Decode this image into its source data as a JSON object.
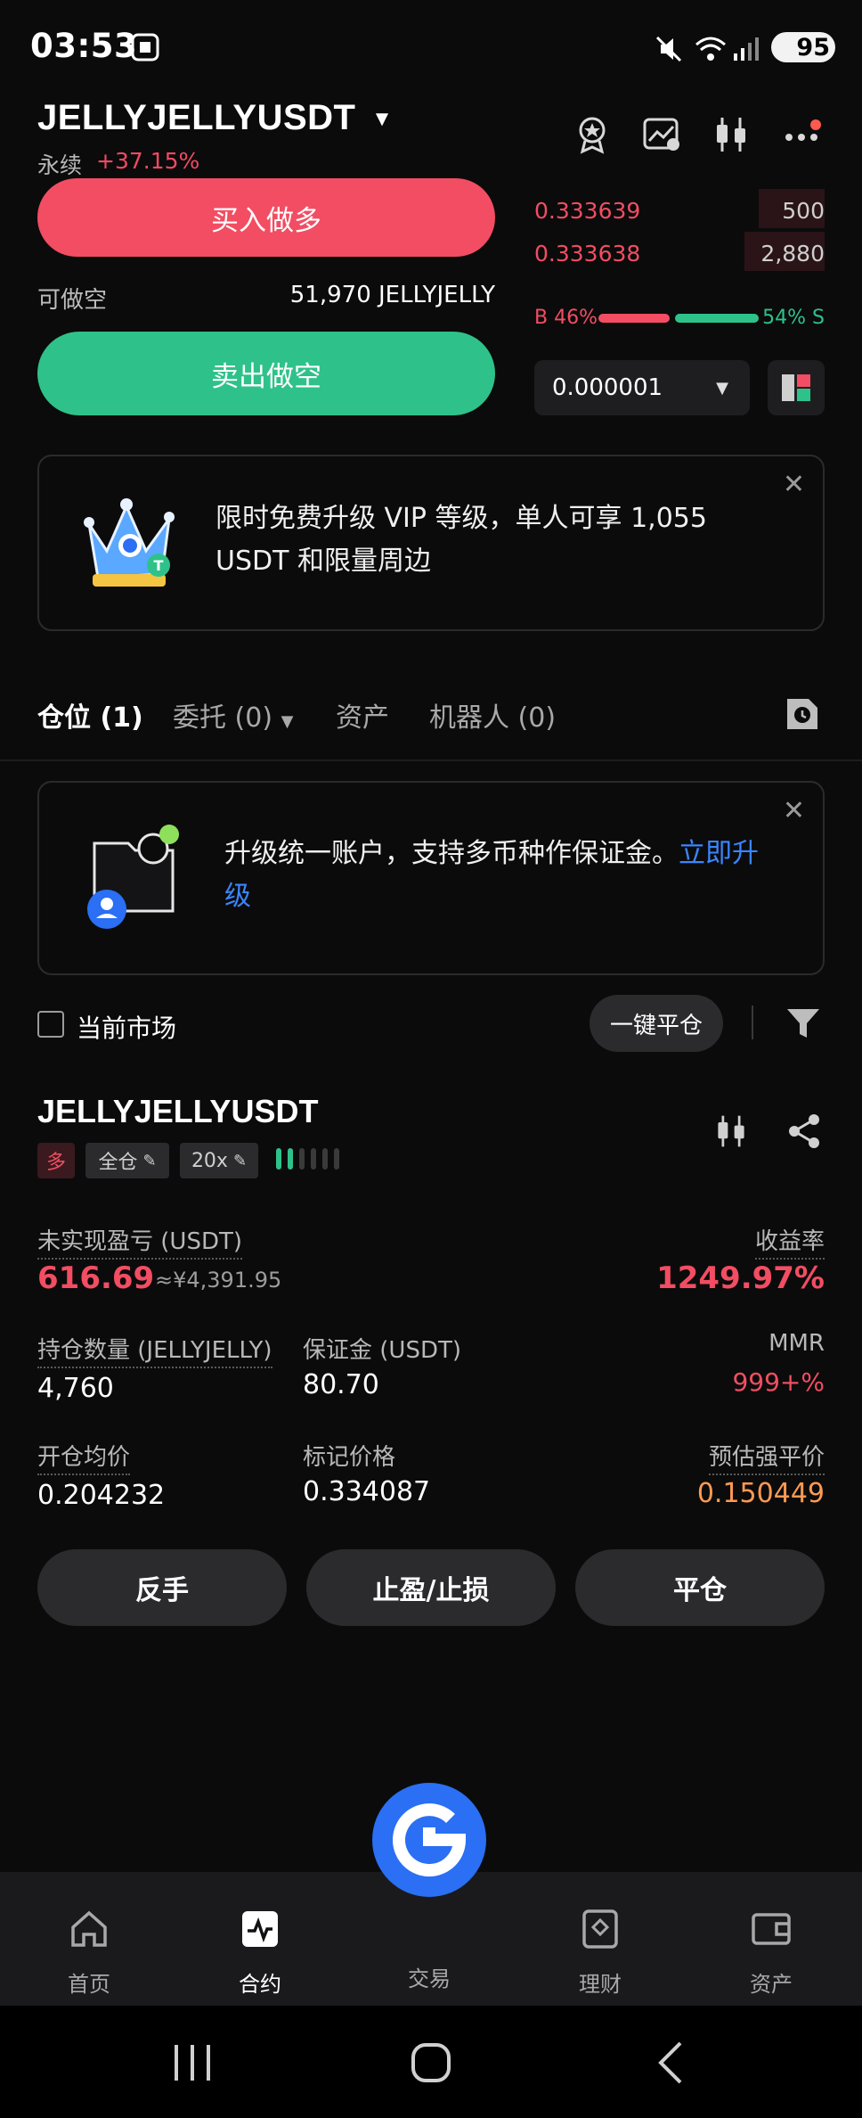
{
  "status_bar": {
    "time": "03:53",
    "battery": "95"
  },
  "header": {
    "symbol": "JELLYJELLYUSDT",
    "type_label": "永续",
    "change": "+37.15%"
  },
  "trade_panel": {
    "buy_label": "买入做多",
    "short_available_label": "可做空",
    "short_available_value": "51,970 JELLYJELLY",
    "sell_label": "卖出做空"
  },
  "orderbook": {
    "asks": [
      {
        "price": "0.333639",
        "qty": "500"
      },
      {
        "price": "0.333638",
        "qty": "2,880"
      }
    ],
    "buy_ratio": "B 46%",
    "sell_ratio": "54% S",
    "buy_fraction": 0.46,
    "precision": "0.000001",
    "colors": {
      "red": "#f24d62",
      "green": "#2ec28a"
    }
  },
  "vip_banner": {
    "text": "限时免费升级 VIP 等级，单人可享 1,055 USDT 和限量周边"
  },
  "tabs": {
    "positions": "仓位 (1)",
    "orders": "委托 (0)",
    "assets": "资产",
    "bots": "机器人 (0)"
  },
  "account_banner": {
    "text": "升级统一账户，支持多币种作保证金。",
    "link": "立即升级"
  },
  "filter": {
    "current_market": "当前市场",
    "close_all": "一键平仓"
  },
  "position": {
    "symbol": "JELLYJELLYUSDT",
    "side": "多",
    "margin_mode": "全仓",
    "leverage": "20x",
    "unrealized_pnl_label": "未实现盈亏 (USDT)",
    "unrealized_pnl": "616.69",
    "unrealized_pnl_cny": "≈¥4,391.95",
    "roe_label": "收益率",
    "roe": "1249.97%",
    "size_label": "持仓数量 (JELLYJELLY)",
    "size": "4,760",
    "margin_label": "保证金 (USDT)",
    "margin": "80.70",
    "mmr_label": "MMR",
    "mmr": "999+%",
    "entry_label": "开仓均价",
    "entry": "0.204232",
    "mark_label": "标记价格",
    "mark": "0.334087",
    "liq_label": "预估强平价",
    "liq": "0.150449",
    "btn_reverse": "反手",
    "btn_tpsl": "止盈/止损",
    "btn_close": "平仓"
  },
  "bottom_nav": {
    "home": "首页",
    "futures": "合约",
    "trade": "交易",
    "earn": "理财",
    "assets": "资产"
  }
}
